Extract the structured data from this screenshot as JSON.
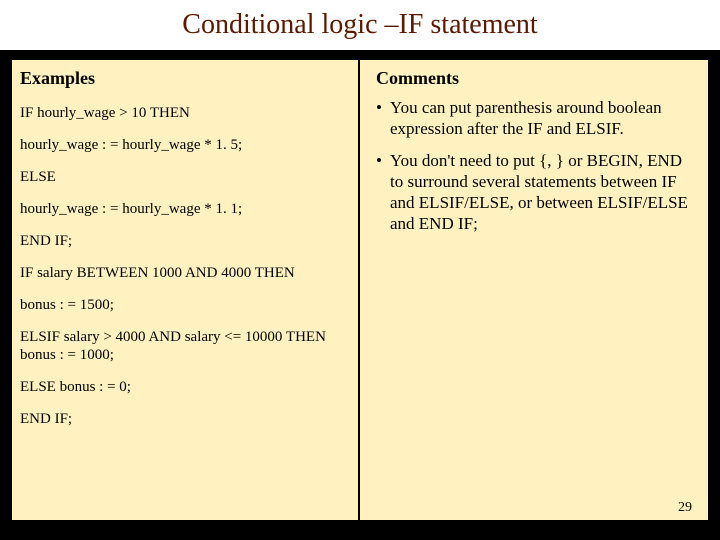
{
  "slide": {
    "title": "Conditional logic –IF statement",
    "page_number": "29",
    "left": {
      "heading": "Examples",
      "code": [
        "IF hourly_wage > 10   THEN",
        "hourly_wage : = hourly_wage * 1. 5;",
        "ELSE",
        "hourly_wage : = hourly_wage * 1. 1;",
        "END IF;",
        "IF salary BETWEEN 1000 AND 4000 THEN",
        "bonus : = 1500;",
        "ELSIF salary > 4000 AND salary <= 10000 THEN bonus : = 1000;",
        "ELSE bonus : = 0;",
        "END IF;"
      ]
    },
    "right": {
      "heading": "Comments",
      "bullets": [
        "You can put parenthesis around boolean expression  after the IF and ELSIF.",
        "You don't need to put {, } or BEGIN, END to surround several statements between IF and ELSIF/ELSE, or between ELSIF/ELSE and END IF;"
      ]
    }
  }
}
